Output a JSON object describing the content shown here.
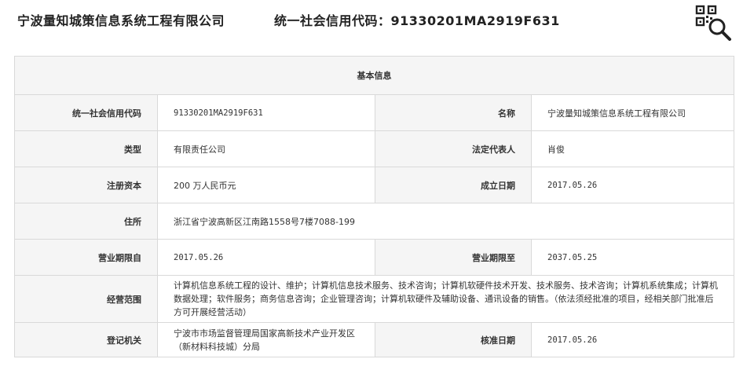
{
  "header": {
    "company_name": "宁波量知城策信息系统工程有限公司",
    "credit_code_line": "统一社会信用代码：91330201MA2919F631",
    "qr_search_icon": "qr-search-icon"
  },
  "basic_info": {
    "section_title": "基本信息",
    "rows": [
      {
        "label": "统一社会信用代码",
        "value": "91330201MA2919F631",
        "label2": "名称",
        "value2": "宁波量知城策信息系统工程有限公司"
      },
      {
        "label": "类型",
        "value": "有限责任公司",
        "label2": "法定代表人",
        "value2": "肖俊"
      },
      {
        "label": "注册资本",
        "value": "200 万人民币元",
        "label2": "成立日期",
        "value2": "2017.05.26"
      },
      {
        "label": "住所",
        "value": "浙江省宁波高新区江南路1558号7楼7088-199"
      },
      {
        "label": "营业期限自",
        "value": "2017.05.26",
        "label2": "营业期限至",
        "value2": "2037.05.25"
      },
      {
        "label": "经营范围",
        "value": "计算机信息系统工程的设计、维护；计算机信息技术服务、技术咨询；计算机软硬件技术开发、技术服务、技术咨询；计算机系统集成；计算机数据处理；软件服务；商务信息咨询；企业管理咨询；计算机软硬件及辅助设备、通讯设备的销售。（依法须经批准的项目，经相关部门批准后方可开展经营活动）"
      },
      {
        "label": "登记机关",
        "value": "宁波市市场监督管理局国家高新技术产业开发区（新材料科技城）分局",
        "label2": "核准日期",
        "value2": "2017.05.26"
      }
    ]
  }
}
